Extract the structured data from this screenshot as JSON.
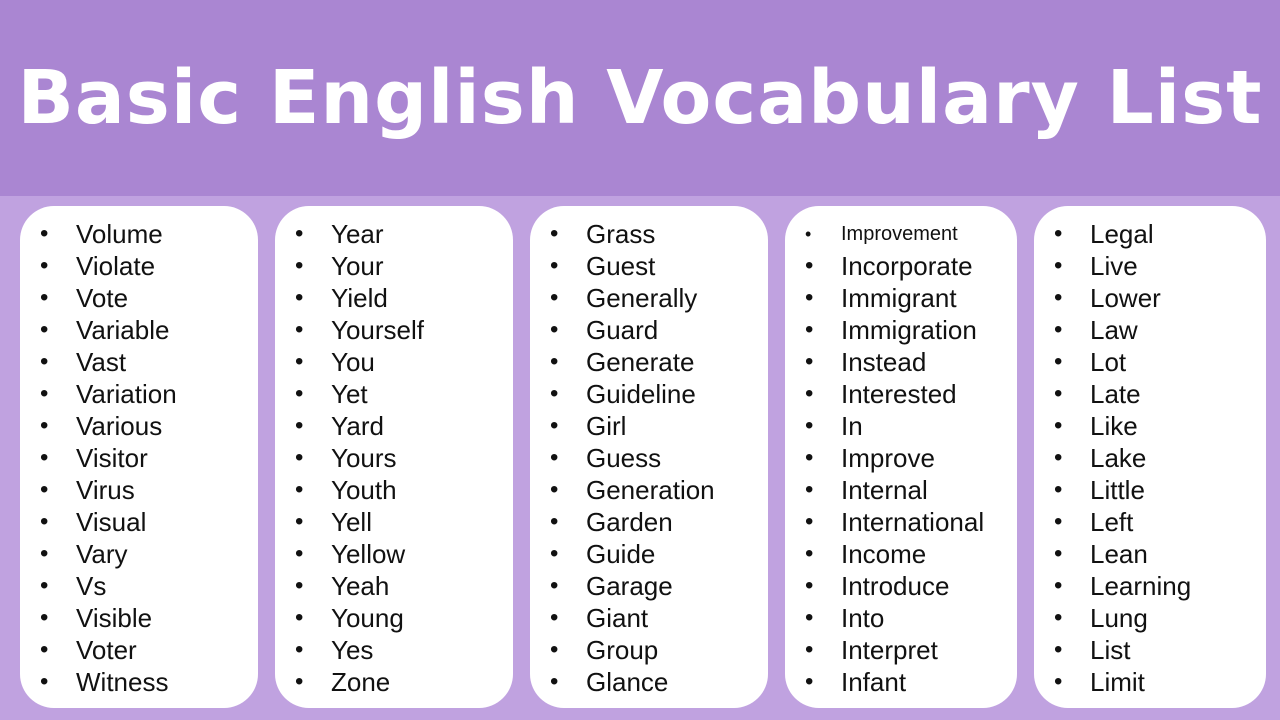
{
  "title": "Basic English Vocabulary List",
  "colors": {
    "header_bg": "#aa86d2",
    "page_bg": "#c0a2e0",
    "card_bg": "#ffffff",
    "title_text": "#ffffff",
    "word_text": "#111111"
  },
  "columns": [
    {
      "words": [
        "Volume",
        "Violate",
        "Vote",
        "Variable",
        "Vast",
        "Variation",
        "Various",
        "Visitor",
        "Virus",
        "Visual",
        "Vary",
        "Vs",
        "Visible",
        "Voter",
        "Witness"
      ]
    },
    {
      "words": [
        "Year",
        "Your",
        "Yield",
        "Yourself",
        "You",
        "Yet",
        "Yard",
        "Yours",
        "Youth",
        "Yell",
        "Yellow",
        "Yeah",
        "Young",
        "Yes",
        "Zone"
      ]
    },
    {
      "words": [
        "Grass",
        "Guest",
        "Generally",
        "Guard",
        "Generate",
        "Guideline",
        "Girl",
        "Guess",
        "Generation",
        "Garden",
        "Guide",
        "Garage",
        "Giant",
        "Group",
        "Glance"
      ]
    },
    {
      "words": [
        "Improvement",
        "Incorporate",
        "Immigrant",
        "Immigration",
        "Instead",
        "Interested",
        "In",
        "Improve",
        "Internal",
        "International",
        "Income",
        "Introduce",
        "Into",
        "Interpret",
        "Infant"
      ]
    },
    {
      "words": [
        "Legal",
        "Live",
        "Lower",
        "Law",
        "Lot",
        "Late",
        "Like",
        "Lake",
        "Little",
        "Left",
        "Lean",
        "Learning",
        "Lung",
        "List",
        "Limit"
      ]
    }
  ]
}
